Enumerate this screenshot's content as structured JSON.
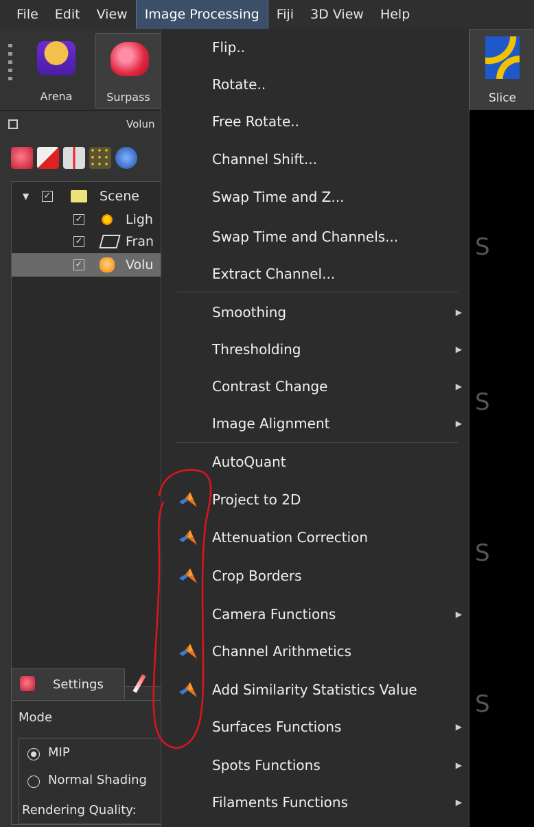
{
  "menubar": {
    "items": [
      "File",
      "Edit",
      "View",
      "Image Processing",
      "Fiji",
      "3D View",
      "Help"
    ],
    "active_index": 3
  },
  "toolbar": {
    "arena_label": "Arena",
    "surpass_label": "Surpass",
    "slice_label": "Slice"
  },
  "panel": {
    "volume_header": "Volun",
    "tree": [
      {
        "label": "Scene",
        "checked": true
      },
      {
        "label": "Ligh",
        "checked": true
      },
      {
        "label": "Fran",
        "checked": true
      },
      {
        "label": "Volu",
        "checked": true,
        "selected": true
      }
    ],
    "settings_tab": "Settings",
    "mode_label": "Mode",
    "radio_mip": "MIP",
    "radio_normal": "Normal Shading",
    "rendering_quality": "Rendering Quality:"
  },
  "viewer": {
    "ghost_letter": "S"
  },
  "menu": {
    "items": [
      {
        "label": "Flip..",
        "submenu": false,
        "matlab": false
      },
      {
        "label": "Rotate..",
        "submenu": false,
        "matlab": false
      },
      {
        "label": "Free Rotate..",
        "submenu": false,
        "matlab": false
      },
      {
        "label": "Channel Shift...",
        "submenu": false,
        "matlab": false
      },
      {
        "label": "Swap Time and Z...",
        "submenu": false,
        "matlab": false
      },
      {
        "label": "Swap Time and Channels...",
        "submenu": false,
        "matlab": false
      },
      {
        "label": "Extract Channel...",
        "submenu": false,
        "matlab": false
      },
      {
        "label": "Smoothing",
        "submenu": true,
        "matlab": false
      },
      {
        "label": "Thresholding",
        "submenu": true,
        "matlab": false
      },
      {
        "label": "Contrast Change",
        "submenu": true,
        "matlab": false
      },
      {
        "label": "Image Alignment",
        "submenu": true,
        "matlab": false
      },
      {
        "label": "AutoQuant",
        "submenu": false,
        "matlab": false
      },
      {
        "label": "Project to 2D",
        "submenu": false,
        "matlab": true
      },
      {
        "label": "Attenuation Correction",
        "submenu": false,
        "matlab": true
      },
      {
        "label": "Crop Borders",
        "submenu": false,
        "matlab": true
      },
      {
        "label": "Camera Functions",
        "submenu": true,
        "matlab": false
      },
      {
        "label": "Channel Arithmetics",
        "submenu": false,
        "matlab": true
      },
      {
        "label": "Add Similarity Statistics Value",
        "submenu": false,
        "matlab": true
      },
      {
        "label": "Surfaces Functions",
        "submenu": true,
        "matlab": false
      },
      {
        "label": "Spots Functions",
        "submenu": true,
        "matlab": false
      },
      {
        "label": "Filaments Functions",
        "submenu": true,
        "matlab": false
      }
    ]
  },
  "icons": {
    "submenu_arrow": "chevron-right-icon",
    "matlab": "matlab-icon"
  },
  "colors": {
    "annotation": "#e0141b",
    "menu_active": "#3b4f68"
  }
}
